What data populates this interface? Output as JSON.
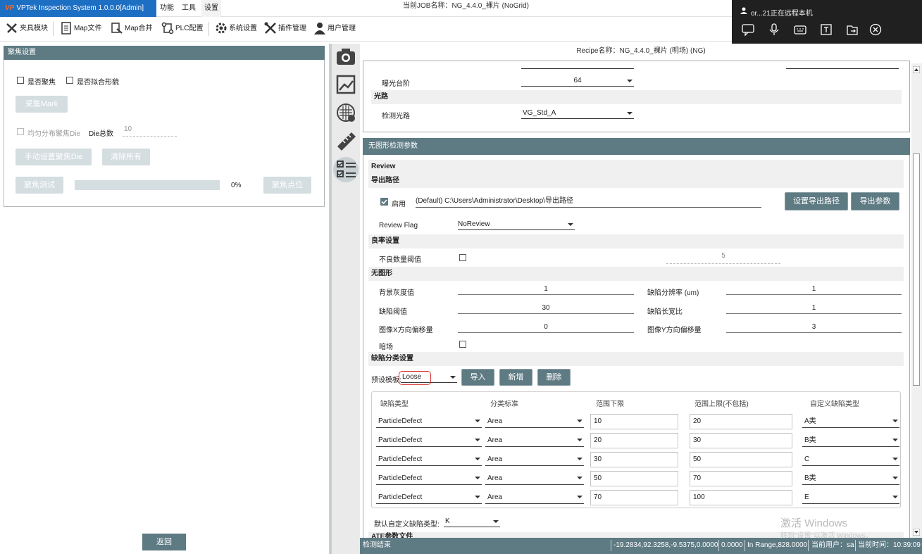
{
  "titlebar": {
    "app_title": "VPTek Inspection System 1.0.0.0[Admin]",
    "logo_text": "VP",
    "menu": [
      "功能",
      "工具",
      "设置"
    ],
    "job_title": "当前JOB名称：NG_4.4.0_裸片 (NoGrid)"
  },
  "toolbar": {
    "items": [
      "夹具模块",
      "Map文件",
      "Map合并",
      "PLC配置",
      "系统设置",
      "插件管理",
      "用户管理"
    ]
  },
  "remote": {
    "title": "or...21正在远程本机"
  },
  "left_panel": {
    "title": "聚焦设置",
    "chk_focus": "是否聚焦",
    "chk_fit": "是否拟合形貌",
    "btn_mark": "采集Mark",
    "chk_uniform": "均匀分布聚焦Die",
    "die_total_label": "Die总数",
    "die_total_value": "10",
    "btn_manual": "手动设置聚焦Die",
    "btn_clear": "清除所有",
    "btn_test": "聚焦测试",
    "progress_text": "0%",
    "progress_value": 0,
    "btn_point": "聚焦点位",
    "return_label": "返回"
  },
  "recipe_title": "Recipe名称：NG_4.4.0_裸片 (明场)  (NG)",
  "panel1": {
    "exposure_label": "曝光台阶",
    "exposure_value": "64",
    "light_section": "光路",
    "light_label": "检测光路",
    "light_value": "VG_Std_A"
  },
  "panel2": {
    "title": "无图形检测参数",
    "review": "Review",
    "export_path_section": "导出路径",
    "enable_label": "启用",
    "enable_checked": true,
    "export_path_value": "(Default) C:\\Users\\Administrator\\Desktop\\导出路径",
    "btn_set_path": "设置导出路径",
    "btn_export": "导出参数",
    "review_flag_label": "Review Flag",
    "review_flag_value": "NoReview",
    "yield_section": "良率设置",
    "bad_count_label": "不良数量阈值",
    "bad_count_value": "5",
    "nopattern_section": "无图形",
    "bg_gray_label": "背景灰度值",
    "bg_gray_value": "1",
    "defect_res_label": "缺陷分辨率 (um)",
    "defect_res_value": "1",
    "defect_thr_label": "缺陷阈值",
    "defect_thr_value": "30",
    "defect_ratio_label": "缺陷长宽比",
    "defect_ratio_value": "1",
    "img_x_label": "图像X方向偏移量",
    "img_x_value": "0",
    "img_y_label": "图像Y方向偏移量",
    "img_y_value": "3",
    "dark_label": "暗场",
    "class_section": "缺陷分类设置",
    "preset_label": "预设模板:",
    "preset_value": "Loose",
    "btn_import": "导入",
    "btn_add": "新增",
    "btn_delete": "删除",
    "default_type_label": "默认自定义缺陷类型:",
    "default_type_value": "K",
    "next_section": "ATE参数文件"
  },
  "table": {
    "headers": [
      "缺陷类型",
      "分类标准",
      "范围下限",
      "范围上限(不包括)",
      "自定义缺陷类型"
    ],
    "rows": [
      [
        "ParticleDefect",
        "Area",
        "10",
        "20",
        "A类"
      ],
      [
        "ParticleDefect",
        "Area",
        "20",
        "30",
        "B类"
      ],
      [
        "ParticleDefect",
        "Area",
        "30",
        "50",
        "C"
      ],
      [
        "ParticleDefect",
        "Area",
        "50",
        "70",
        "B类"
      ],
      [
        "ParticleDefect",
        "Area",
        "70",
        "100",
        "E"
      ]
    ]
  },
  "statusbar": {
    "message": "检测结束",
    "coords": "-19.2834,92.3258,-9.5375,0.0000",
    "value": "0.0000",
    "range": "In Range,828.0000",
    "user": "当前用户：sa",
    "time": "当前时间：10:39:09"
  },
  "watermark": {
    "line1": "激活 Windows",
    "line2": "转到\"设置\"以激活 Windows。"
  },
  "colors": {
    "header_bg": "#5e7a83",
    "title_blue": "#1d6fc4",
    "highlight_red": "#d9302b"
  }
}
